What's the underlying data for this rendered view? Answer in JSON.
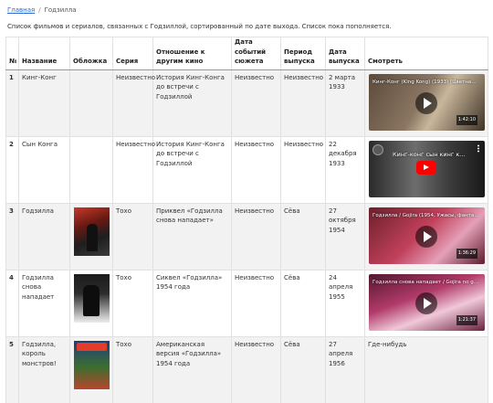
{
  "breadcrumb": {
    "home": "Главная",
    "separator": "/",
    "current": "Годзилла"
  },
  "intro": "Список фильмов и сериалов, связанных с Годзиллой, сортированный по дате выхода. Список пока пополняется.",
  "table": {
    "headers": {
      "num": "№",
      "title": "Название",
      "cover": "Обложка",
      "series": "Серия",
      "relation": "Отношение к другим кино",
      "plot_date": "Дата событий сюжета",
      "era": "Период выпуска",
      "release": "Дата выпуска",
      "watch": "Смотреть"
    },
    "rows": [
      {
        "num": "1",
        "title": "Кинг-Конг",
        "series": "Неизвестно",
        "relation": "История Кинг-Конга до встречи с Годзиллой",
        "plot_date": "Неизвестно",
        "era": "Неизвестно",
        "release": "2 марта 1933",
        "video_title": "Кинг-Конг (King Kong) (1933) [Цветная в...",
        "video_duration": "1:42:10"
      },
      {
        "num": "2",
        "title": "Сын Конга",
        "series": "Неизвестно",
        "relation": "История Кинг-Конга до встречи с Годзиллой",
        "plot_date": "Неизвестно",
        "era": "Неизвестно",
        "release": "22 декабря 1933",
        "video_title": "Кинг-конг сын кинг к..."
      },
      {
        "num": "3",
        "title": "Годзилла",
        "series": "Тохо",
        "relation": "Приквел «Годзилла снова нападает»",
        "plot_date": "Неизвестно",
        "era": "Сёва",
        "release": "27 октября 1954",
        "video_title": "Годзилла / Gojira (1954, Ужасы, фантас...",
        "video_duration": "1:36:29"
      },
      {
        "num": "4",
        "title": "Годзилла снова нападает",
        "series": "Тохо",
        "relation": "Сиквел «Годзилла» 1954 года",
        "plot_date": "Неизвестно",
        "era": "Сёва",
        "release": "24 апреля 1955",
        "video_title": "Годзилла снова нападает / Gojira no gya...",
        "video_duration": "1:21:37"
      },
      {
        "num": "5",
        "title": "Годзилла, король монстров!",
        "series": "Тохо",
        "relation": "Американская версия «Годзилла» 1954 года",
        "plot_date": "Неизвестно",
        "era": "Сёва",
        "release": "27 апреля 1956",
        "watch_text": "Где-нибудь"
      }
    ]
  },
  "colors": {
    "link": "#2a6bd6",
    "row_alt": "#f2f2f2",
    "youtube_red": "#ff0000"
  }
}
